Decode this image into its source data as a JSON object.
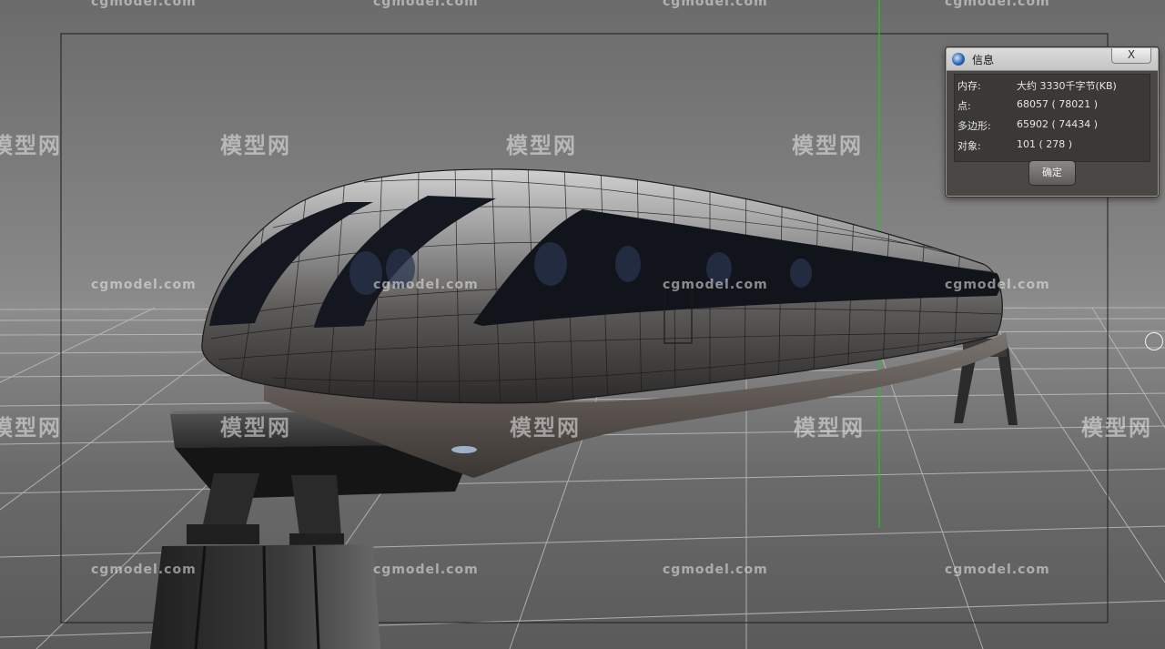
{
  "dialog": {
    "title": "信息",
    "close_label": "X",
    "rows": [
      {
        "label": "内存:",
        "value": "大约 3330千字节(KB)"
      },
      {
        "label": "点:",
        "value": "68057 ( 78021 )"
      },
      {
        "label": "多边形:",
        "value": "65902 ( 74434 )"
      },
      {
        "label": "对象:",
        "value": "101 ( 278 )"
      }
    ],
    "ok_label": "确定"
  },
  "watermarks": {
    "url": "cgmodel.com",
    "brand": "模型网"
  },
  "colors": {
    "viewport_bg": "#7a7a7a",
    "grid_line": "#bcbcbc",
    "y_axis": "#1ec81e",
    "dialog_bg": "#4a4845"
  }
}
